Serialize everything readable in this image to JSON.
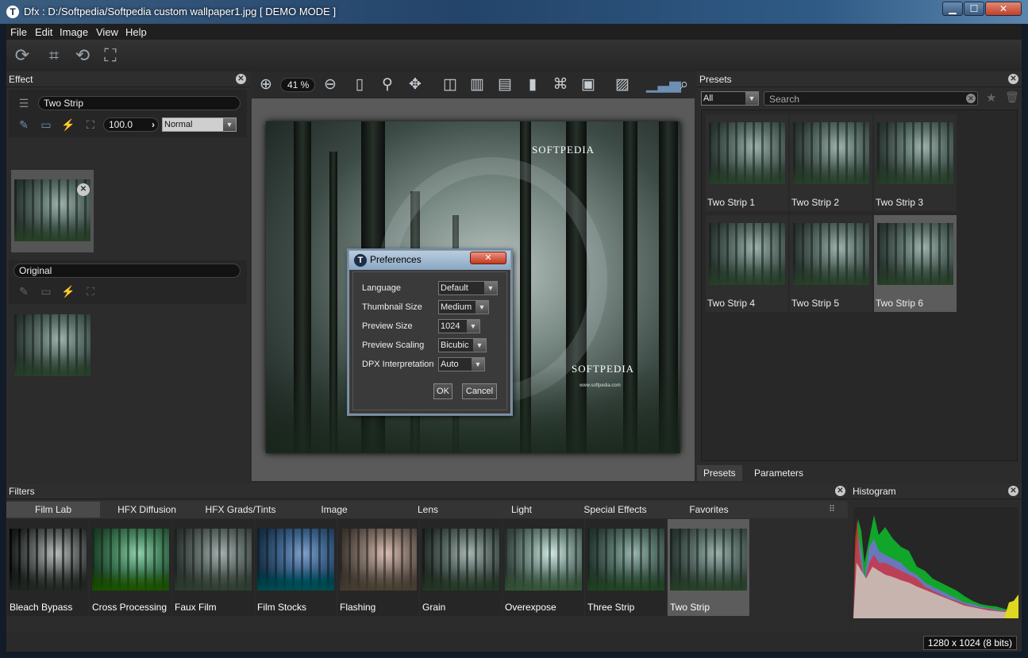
{
  "window": {
    "title": "Dfx : D:/Softpedia/Softpedia custom wallpaper1.jpg [ DEMO MODE ]",
    "app_icon": "T",
    "min": "▁",
    "max": "☐",
    "close": "✕"
  },
  "menu": [
    "File",
    "Edit",
    "Image",
    "View",
    "Help"
  ],
  "effect_panel": {
    "title": "Effect",
    "effect_name": "Two Strip",
    "opacity": "100.0",
    "blend_mode": "Normal",
    "original_label": "Original"
  },
  "view_toolbar": {
    "zoom": "41 %"
  },
  "preview_watermarks": {
    "brand_top": "SOFTPEDIA",
    "brand_bottom": "SOFTPEDIA",
    "url": "www.softpedia.com"
  },
  "preferences": {
    "title": "Preferences",
    "rows": [
      {
        "label": "Language",
        "value": "Default"
      },
      {
        "label": "Thumbnail Size",
        "value": "Medium"
      },
      {
        "label": "Preview Size",
        "value": "1024"
      },
      {
        "label": "Preview Scaling",
        "value": "Bicubic"
      },
      {
        "label": "DPX Interpretation",
        "value": "Auto"
      }
    ],
    "ok": "OK",
    "cancel": "Cancel"
  },
  "presets_panel": {
    "title": "Presets",
    "filter": "All",
    "search_placeholder": "Search",
    "items": [
      "Two Strip 1",
      "Two Strip 2",
      "Two Strip 3",
      "Two Strip 4",
      "Two Strip 5",
      "Two Strip 6"
    ],
    "selected": "Two Strip 6",
    "tabs": [
      "Presets",
      "Parameters"
    ]
  },
  "filters_panel": {
    "title": "Filters",
    "tabs": [
      "Film Lab",
      "HFX Diffusion",
      "HFX Grads/Tints",
      "Image",
      "Lens",
      "Light",
      "Special Effects",
      "Favorites"
    ],
    "items": [
      "Bleach Bypass",
      "Cross Processing",
      "Faux Film",
      "Film Stocks",
      "Flashing",
      "Grain",
      "Overexpose",
      "Three Strip",
      "Two Strip"
    ],
    "selected": "Two Strip"
  },
  "histogram_panel": {
    "title": "Histogram"
  },
  "status": {
    "resolution": "1280 x 1024 (8 bits)"
  },
  "colors": {
    "accent": "#6d8fb4",
    "panel": "#2c2c2c",
    "selected": "#5c5c5c"
  }
}
